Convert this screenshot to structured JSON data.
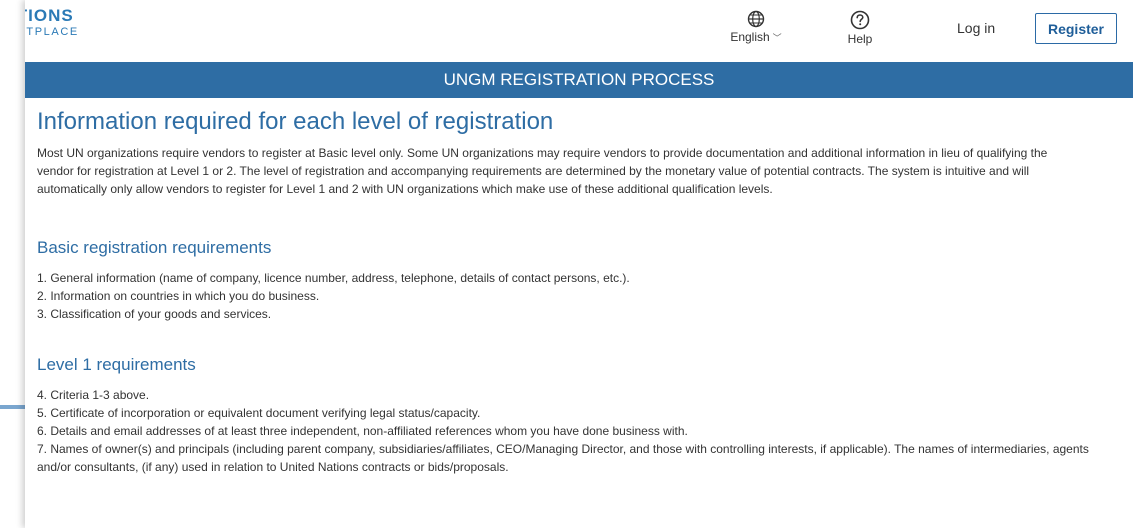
{
  "header": {
    "logo_line1": "IATIONS",
    "logo_line2": "RKETPLACE",
    "language_label": "English",
    "language_icon": "globe-icon",
    "help_label": "Help",
    "help_icon": "question-circle-icon",
    "login_label": "Log in",
    "register_label": "Register"
  },
  "banner": {
    "title": "UNGM REGISTRATION PROCESS"
  },
  "main": {
    "title": "Information required for each level of registration",
    "intro": "Most UN organizations require vendors to register at Basic level only. Some UN organizations may require vendors to provide documentation and additional information in lieu of qualifying the vendor for registration at Level 1 or 2. The level of registration and accompanying requirements are determined by the monetary value of potential contracts. The system is intuitive and will automatically only allow vendors to register for Level 1 and 2 with UN organizations which make use of these additional qualification levels.",
    "sections": [
      {
        "title": "Basic registration requirements",
        "items": [
          "1. General information (name of company, licence number, address, telephone, details of contact persons, etc.).",
          "2. Information on countries in which you do business.",
          "3. Classification of your goods and services."
        ]
      },
      {
        "title": "Level 1 requirements",
        "items": [
          "4. Criteria 1-3 above.",
          "5. Certificate of incorporation or equivalent document verifying legal status/capacity.",
          "6. Details and email addresses of at least three independent, non-affiliated references whom you have done business with.",
          "7. Names of owner(s) and principals (including parent company, subsidiaries/affiliates, CEO/Managing Director, and those with controlling interests, if applicable). The names of intermediaries, agents and/or consultants, (if any) used in relation to United Nations contracts or bids/proposals."
        ]
      }
    ]
  },
  "colors": {
    "brand_blue": "#2e6da4",
    "banner_text": "#ffffff",
    "body_text": "#333333"
  }
}
